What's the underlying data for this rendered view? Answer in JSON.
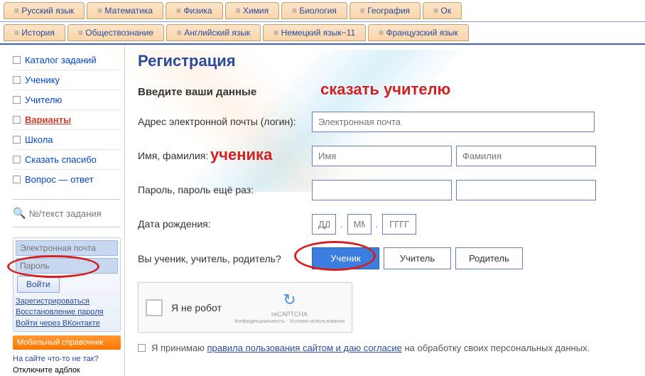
{
  "tabs_row1": [
    "Русский язык",
    "Математика",
    "Физика",
    "Химия",
    "Биология",
    "География",
    "Ок"
  ],
  "tabs_row2": [
    "История",
    "Обществознание",
    "Английский язык",
    "Немецкий язык−11",
    "Французский язык"
  ],
  "sidebar": {
    "items": [
      {
        "label": "Каталог заданий"
      },
      {
        "label": "Ученику"
      },
      {
        "label": "Учителю"
      },
      {
        "label": "Варианты",
        "active": true
      },
      {
        "label": "Школа"
      },
      {
        "label": "Сказать спасибо"
      },
      {
        "label": "Вопрос — ответ"
      }
    ],
    "search_placeholder": "№/текст задания"
  },
  "login": {
    "email_ph": "Электронная почта",
    "pwd_ph": "Пароль",
    "btn": "Войти",
    "register": "Зарегистрироваться",
    "restore": "Восстановление пароля",
    "vk": "Войти через ВКонтакте"
  },
  "mobile_ref": "Мобильный справочник",
  "footer": {
    "l1": "На сайте что-то не так?",
    "l2": "Отключите адблок"
  },
  "page_title": "Регистрация",
  "section_label": "Введите ваши данные",
  "form": {
    "email_lab": "Адрес электронной почты (логин):",
    "email_ph": "Электронная почта",
    "name_lab": "Имя, фамилия:",
    "name_ph": "Имя",
    "surname_ph": "Фамилия",
    "pwd_lab": "Пароль, пароль ещё раз:",
    "dob_lab": "Дата рождения:",
    "dd": "ДД",
    "mm": "ММ",
    "yyyy": "ГГГГ",
    "role_lab": "Вы ученик, учитель, родитель?",
    "roles": [
      "Ученик",
      "Учитель",
      "Родитель"
    ]
  },
  "captcha": {
    "label": "Я не робот",
    "brand": "reCAPTCHA",
    "legal": "Конфиденциальность - Условия использования"
  },
  "consent": {
    "prefix": "Я принимаю ",
    "link": "правила пользования сайтом и даю согласие",
    "suffix": " на обработку своих персональных данных."
  },
  "annotations": {
    "teacher": "сказать учителю",
    "student": "ученика"
  }
}
